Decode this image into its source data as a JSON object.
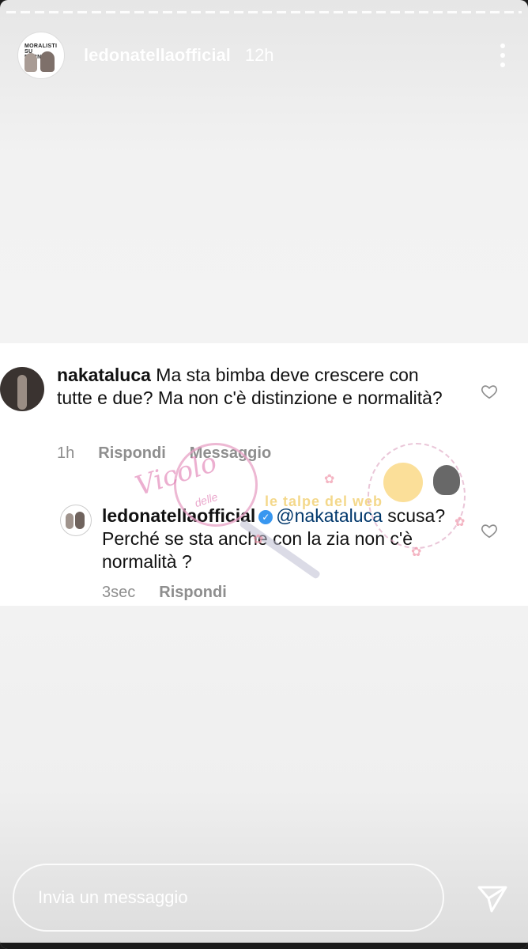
{
  "story": {
    "username": "ledonatellaofficial",
    "time": "12h",
    "avatar_poster_text": "MORALISTI SU PORNHUB",
    "more_icon": "more-vertical-icon"
  },
  "comments": [
    {
      "username": "nakataluca",
      "text": "Ma sta bimba deve crescere con tutte e due? Ma non c'è distinzione e normalità?",
      "time": "1h",
      "reply_label": "Rispondi",
      "message_label": "Messaggio",
      "like_icon": "heart-icon"
    },
    {
      "username": "ledonatellaofficial",
      "verified_icon": "verified-badge-icon",
      "mention": "@nakataluca",
      "text": "scusa? Perché se sta anche con la zia non c'è normalità ?",
      "time": "3sec",
      "reply_label": "Rispondi",
      "like_icon": "heart-icon"
    }
  ],
  "watermark": {
    "script_text": "Vicolo",
    "small_text": "delle",
    "brand_text": "le talpe del web"
  },
  "composer": {
    "placeholder": "Invia un messaggio",
    "send_icon": "send-icon"
  },
  "colors": {
    "verified": "#3897f0",
    "mention": "#00376b",
    "meta": "#8e8e8e"
  }
}
